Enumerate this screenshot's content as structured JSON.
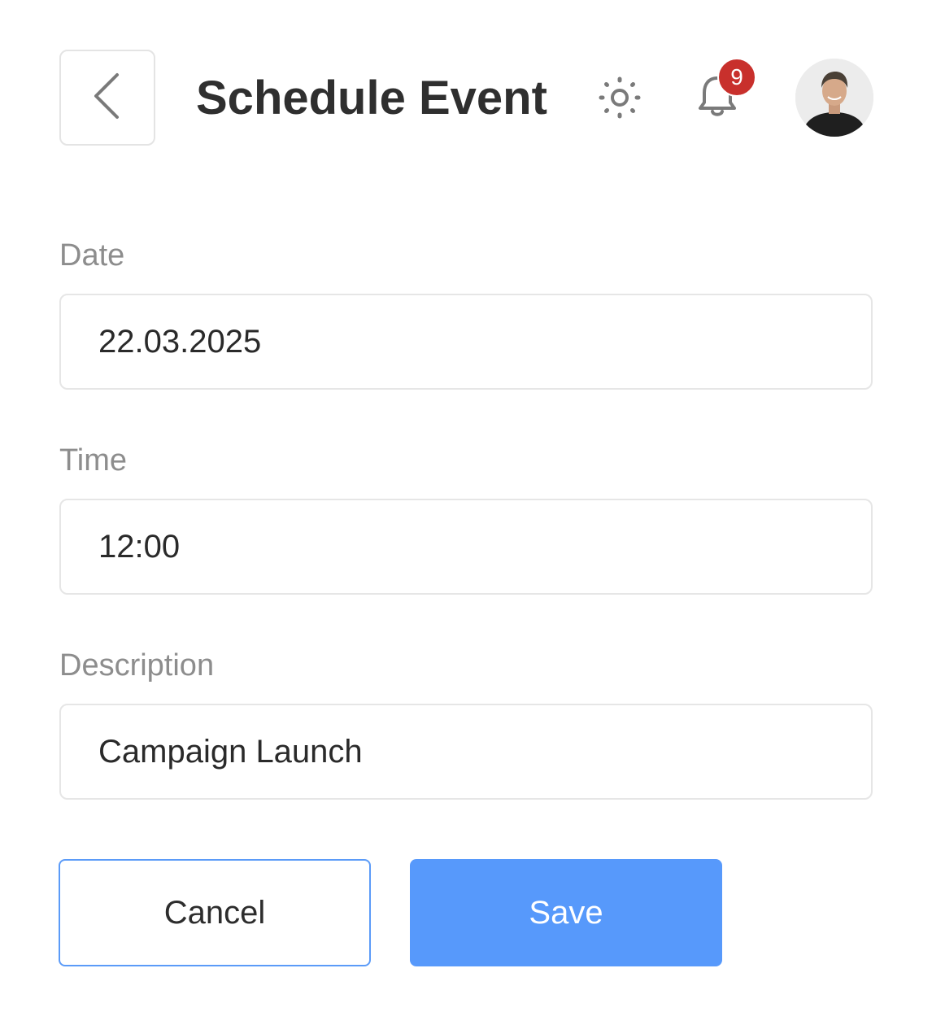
{
  "header": {
    "title": "Schedule Event",
    "back_icon": "chevron-left-icon",
    "theme_icon": "sun-icon",
    "notification_icon": "bell-icon",
    "notification_count": "9",
    "badge_color": "#c8302c"
  },
  "form": {
    "date": {
      "label": "Date",
      "value": "22.03.2025"
    },
    "time": {
      "label": "Time",
      "value": "12:00"
    },
    "description": {
      "label": "Description",
      "value": "Campaign Launch"
    }
  },
  "actions": {
    "cancel_label": "Cancel",
    "save_label": "Save",
    "accent_color": "#5799fb"
  }
}
